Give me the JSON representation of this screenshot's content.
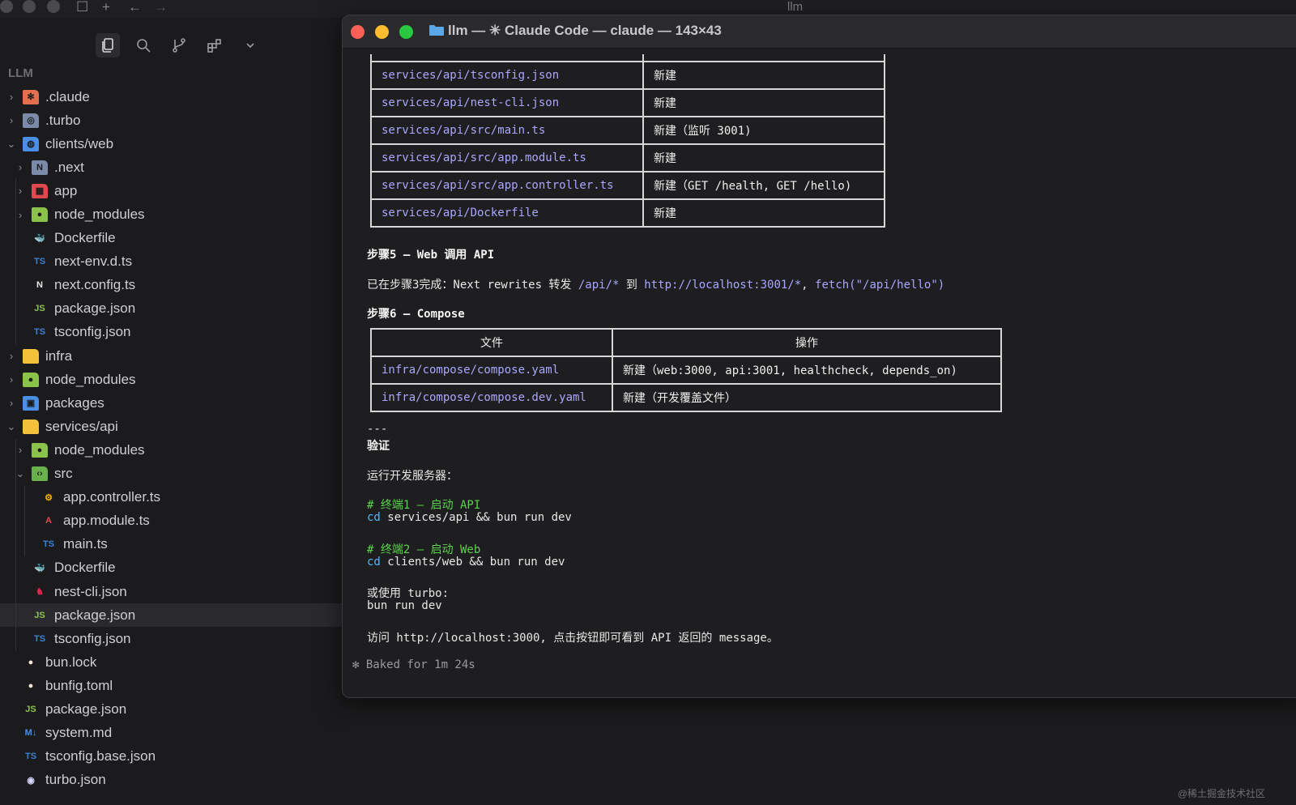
{
  "editor": {
    "title": "llm"
  },
  "sidebar": {
    "section": "LLM",
    "tree": [
      {
        "name": ".claude",
        "depth": 0,
        "chevron": "right",
        "icon": "claude-folder-icon",
        "color": "#e2704f"
      },
      {
        "name": ".turbo",
        "depth": 0,
        "chevron": "right",
        "icon": "turbo-folder-icon",
        "color": "#7a8aa8"
      },
      {
        "name": "clients/web",
        "depth": 0,
        "chevron": "down",
        "icon": "web-folder-icon",
        "color": "#4a8ee6"
      },
      {
        "name": ".next",
        "depth": 1,
        "chevron": "right",
        "icon": "next-folder-icon",
        "color": "#7a8aa8"
      },
      {
        "name": "app",
        "depth": 1,
        "chevron": "right",
        "icon": "app-folder-icon",
        "color": "#e0474f"
      },
      {
        "name": "node_modules",
        "depth": 1,
        "chevron": "right",
        "icon": "node-folder-icon",
        "color": "#8bc34a"
      },
      {
        "name": "Dockerfile",
        "depth": 1,
        "chevron": "",
        "icon": "docker-icon",
        "color": "#2f8ee6"
      },
      {
        "name": "next-env.d.ts",
        "depth": 1,
        "chevron": "",
        "icon": "ts-icon",
        "color": "#3b82d6"
      },
      {
        "name": "next.config.ts",
        "depth": 1,
        "chevron": "",
        "icon": "next-icon",
        "color": "#e8e8e8"
      },
      {
        "name": "package.json",
        "depth": 1,
        "chevron": "",
        "icon": "nodejs-icon",
        "color": "#8bc34a"
      },
      {
        "name": "tsconfig.json",
        "depth": 1,
        "chevron": "",
        "icon": "tsconfig-icon",
        "color": "#3b82d6"
      },
      {
        "name": "infra",
        "depth": 0,
        "chevron": "right",
        "icon": "infra-folder-icon",
        "color": "#f3c13a"
      },
      {
        "name": "node_modules",
        "depth": 0,
        "chevron": "right",
        "icon": "node-folder-icon",
        "color": "#8bc34a"
      },
      {
        "name": "packages",
        "depth": 0,
        "chevron": "right",
        "icon": "packages-folder-icon",
        "color": "#4a8ee6"
      },
      {
        "name": "services/api",
        "depth": 0,
        "chevron": "down",
        "icon": "api-folder-icon",
        "color": "#f3c13a"
      },
      {
        "name": "node_modules",
        "depth": 1,
        "chevron": "right",
        "icon": "node-folder-icon",
        "color": "#8bc34a"
      },
      {
        "name": "src",
        "depth": 1,
        "chevron": "down",
        "icon": "src-folder-icon",
        "color": "#6ab04c"
      },
      {
        "name": "app.controller.ts",
        "depth": 2,
        "chevron": "",
        "icon": "controller-icon",
        "color": "#f5b301"
      },
      {
        "name": "app.module.ts",
        "depth": 2,
        "chevron": "",
        "icon": "angular-icon",
        "color": "#e0474f"
      },
      {
        "name": "main.ts",
        "depth": 2,
        "chevron": "",
        "icon": "ts-icon",
        "color": "#3b82d6"
      },
      {
        "name": "Dockerfile",
        "depth": 1,
        "chevron": "",
        "icon": "docker-icon",
        "color": "#2f8ee6"
      },
      {
        "name": "nest-cli.json",
        "depth": 1,
        "chevron": "",
        "icon": "nest-icon",
        "color": "#e0234e"
      },
      {
        "name": "package.json",
        "depth": 1,
        "chevron": "",
        "icon": "nodejs-icon",
        "color": "#8bc34a",
        "selected": true
      },
      {
        "name": "tsconfig.json",
        "depth": 1,
        "chevron": "",
        "icon": "tsconfig-icon",
        "color": "#3b82d6"
      },
      {
        "name": "bun.lock",
        "depth": 0,
        "chevron": "",
        "icon": "bun-icon",
        "color": "#f6e6d2"
      },
      {
        "name": "bunfig.toml",
        "depth": 0,
        "chevron": "",
        "icon": "bun-icon",
        "color": "#f6e6d2"
      },
      {
        "name": "package.json",
        "depth": 0,
        "chevron": "",
        "icon": "nodejs-icon",
        "color": "#8bc34a"
      },
      {
        "name": "system.md",
        "depth": 0,
        "chevron": "",
        "icon": "markdown-icon",
        "color": "#4a8ee6"
      },
      {
        "name": "tsconfig.base.json",
        "depth": 0,
        "chevron": "",
        "icon": "tsconfig-icon",
        "color": "#3b82d6"
      },
      {
        "name": "turbo.json",
        "depth": 0,
        "chevron": "",
        "icon": "turbo-icon",
        "color": "#d6d6ff"
      }
    ]
  },
  "terminal": {
    "title": "llm — ✳ Claude Code — claude — 143×43",
    "table1": [
      {
        "file": "services/api/tsconfig.json",
        "op": "新建"
      },
      {
        "file": "services/api/nest-cli.json",
        "op": "新建"
      },
      {
        "file": "services/api/src/main.ts",
        "op": "新建（监听 3001)"
      },
      {
        "file": "services/api/src/app.module.ts",
        "op": "新建"
      },
      {
        "file": "services/api/src/app.controller.ts",
        "op": "新建（GET /health, GET /hello)"
      },
      {
        "file": "services/api/Dockerfile",
        "op": "新建"
      }
    ],
    "step5_heading": "步骤5 – Web 调用 API",
    "step5_prefix": "已在步骤3完成：Next rewrites 转发 ",
    "step5_api_pattern": "/api/*",
    "step5_to": " 到 ",
    "step5_target": "http://localhost:3001/*",
    "step5_sep": ", ",
    "step5_fetch": "fetch(\"/api/hello\")",
    "step6_heading": "步骤6 – Compose",
    "table2_headers": [
      "文件",
      "操作"
    ],
    "table2": [
      {
        "file": "infra/compose/compose.yaml",
        "op": "新建（web:3000, api:3001, healthcheck, depends_on)"
      },
      {
        "file": "infra/compose/compose.dev.yaml",
        "op": "新建（开发覆盖文件）"
      }
    ],
    "hr": "---",
    "verify_heading": "验证",
    "run_label": "运行开发服务器：",
    "comment1": "# 终端1 – 启动 API",
    "cmd1_kw": "cd",
    "cmd1_rest": " services/api && bun run dev",
    "comment2": "# 终端2 – 启动 Web",
    "cmd2_kw": "cd",
    "cmd2_rest": " clients/web && bun run dev",
    "or_turbo": "或使用 turbo:",
    "turbo_cmd": "bun run dev",
    "visit_text": "访问 http://localhost:3000, 点击按钮即可看到 API 返回的 message。",
    "status": "✻ Baked for 1m 24s"
  },
  "watermark": "@稀土掘金技术社区"
}
